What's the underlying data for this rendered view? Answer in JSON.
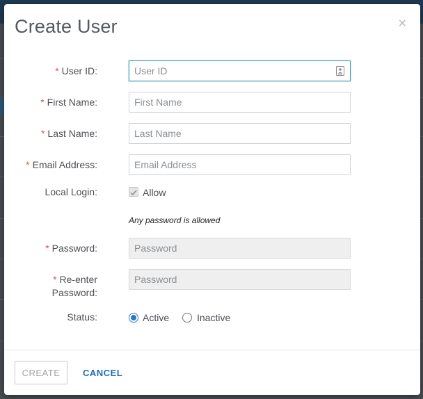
{
  "dialog": {
    "title": "Create User",
    "close_glyph": "×",
    "close_icon": "close-icon"
  },
  "form": {
    "user_id": {
      "required": true,
      "label": "User ID:",
      "placeholder": "User ID",
      "value": "",
      "icon": "contact-card-icon"
    },
    "first_name": {
      "required": true,
      "label": "First Name:",
      "placeholder": "First Name",
      "value": ""
    },
    "last_name": {
      "required": true,
      "label": "Last Name:",
      "placeholder": "Last Name",
      "value": ""
    },
    "email": {
      "required": true,
      "label": "Email Address:",
      "placeholder": "Email Address",
      "value": ""
    },
    "local_login": {
      "label": "Local Login:",
      "option_label": "Allow",
      "checked": true,
      "disabled": true
    },
    "password_hint": "Any password is allowed",
    "password": {
      "required": true,
      "label": "Password:",
      "placeholder": "Password",
      "value": "",
      "disabled": true
    },
    "reenter_password": {
      "required": true,
      "label_line1": "Re-enter",
      "label_line2": "Password:",
      "placeholder": "Password",
      "value": "",
      "disabled": true
    },
    "status": {
      "label": "Status:",
      "options": [
        "Active",
        "Inactive"
      ],
      "selected": "Active"
    }
  },
  "footer": {
    "create_label": "CREATE",
    "cancel_label": "CANCEL"
  },
  "required_marker": "*",
  "colors": {
    "accent": "#1f6fb2",
    "required": "#d9534f",
    "focus_border": "#3f9bb3",
    "radio_selected": "#2a79c7"
  }
}
